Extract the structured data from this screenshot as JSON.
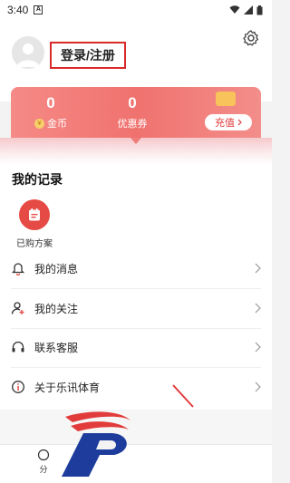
{
  "status_bar": {
    "time": "3:40",
    "notification_letter": "A"
  },
  "header": {
    "login_label": "登录/注册"
  },
  "wallet": {
    "coins": {
      "value": "0",
      "label": "金币"
    },
    "coupons": {
      "value": "0",
      "label": "优惠券"
    },
    "recharge_label": "充值"
  },
  "records": {
    "title": "我的记录",
    "purchased_label": "已购方案"
  },
  "menu": [
    {
      "label": "我的消息",
      "icon": "bell-icon"
    },
    {
      "label": "我的关注",
      "icon": "follow-user-icon"
    },
    {
      "label": "联系客服",
      "icon": "headset-icon"
    },
    {
      "label": "关于乐讯体育",
      "icon": "info-icon"
    }
  ],
  "tabbar": {
    "partial_label": "分"
  },
  "colors": {
    "accent": "#e64a44",
    "wallet_bg": "#f0726f"
  }
}
